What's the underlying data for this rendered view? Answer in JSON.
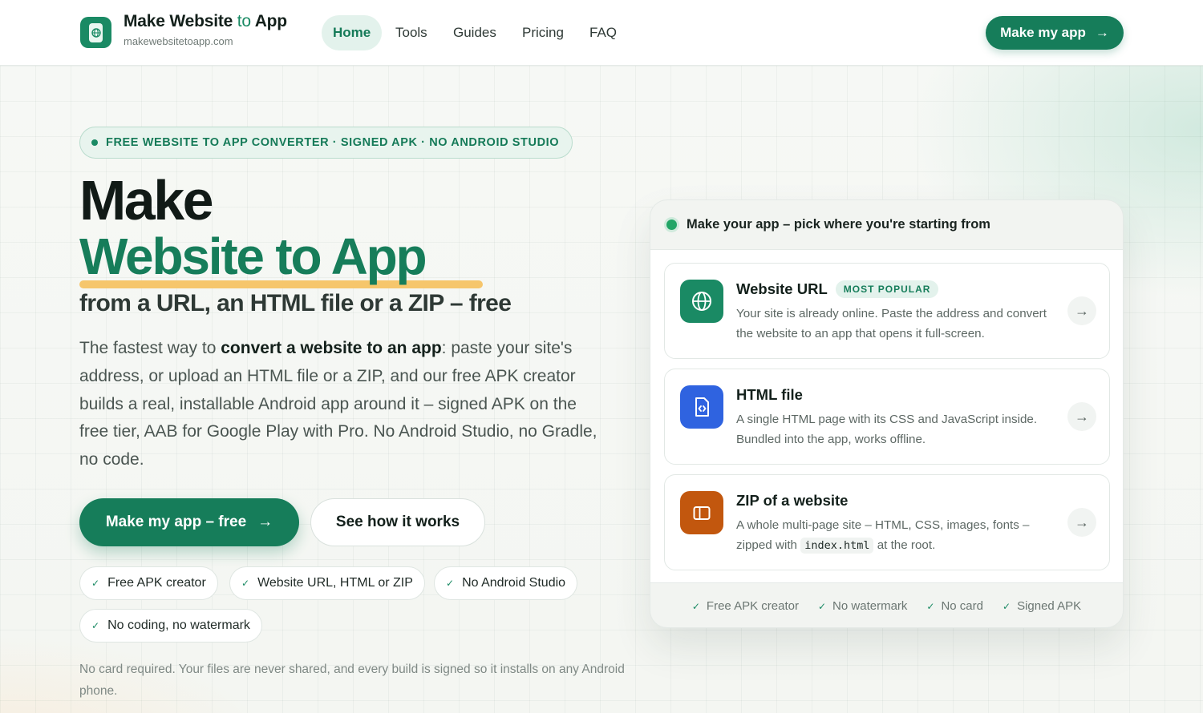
{
  "header": {
    "brand_title_1": "Make Website ",
    "brand_title_to": "to",
    "brand_title_2": " App",
    "brand_domain": "makewebsitetoapp.com",
    "nav": [
      "Home",
      "Tools",
      "Guides",
      "Pricing",
      "FAQ"
    ],
    "active_nav": "Home",
    "cta_label": "Make my app"
  },
  "hero": {
    "pill": "FREE WEBSITE TO APP CONVERTER · SIGNED APK · NO ANDROID STUDIO",
    "title_line1": "Make",
    "title_line2": "Website to App",
    "subtitle": "from a URL, an HTML file or a ZIP – free",
    "lead_1": "The fastest way to ",
    "lead_bold": "convert a website to an app",
    "lead_2": ": paste your site's address, or upload an HTML file or a ZIP, and our free APK creator builds a real, installable Android app around it – signed APK on the free tier, AAB for Google Play with Pro. No Android Studio, no Gradle, no code.",
    "primary_button": "Make my app – free",
    "secondary_button": "See how it works",
    "chips": [
      "Free APK creator",
      "Website URL, HTML or ZIP",
      "No Android Studio",
      "No coding, no watermark"
    ],
    "footnote": "No card required. Your files are never shared, and every build is signed so it installs on any Android phone."
  },
  "panel": {
    "heading": "Make your app – pick where you're starting from",
    "options": [
      {
        "title": "Website URL",
        "badge": "MOST POPULAR",
        "desc": "Your site is already online. Paste the address and convert the website to an app that opens it full-screen.",
        "icon": "globe-icon",
        "color": "#1a8a64"
      },
      {
        "title": "HTML file",
        "desc": "A single HTML page with its CSS and JavaScript inside. Bundled into the app, works offline.",
        "icon": "code-file-icon",
        "color": "#2f63e0"
      },
      {
        "title": "ZIP of a website",
        "desc_1": "A whole multi-page site – HTML, CSS, images, fonts – zipped with ",
        "desc_code": "index.html",
        "desc_2": " at the root.",
        "icon": "folder-icon",
        "color": "#c2570e"
      }
    ],
    "footer_items": [
      "Free APK creator",
      "No watermark",
      "No card",
      "Signed APK"
    ]
  },
  "colors": {
    "brand_green": "#167d5a",
    "highlight_yellow": "#f6c66c",
    "blue_accent": "#2f63e0",
    "orange_accent": "#c2570e"
  }
}
